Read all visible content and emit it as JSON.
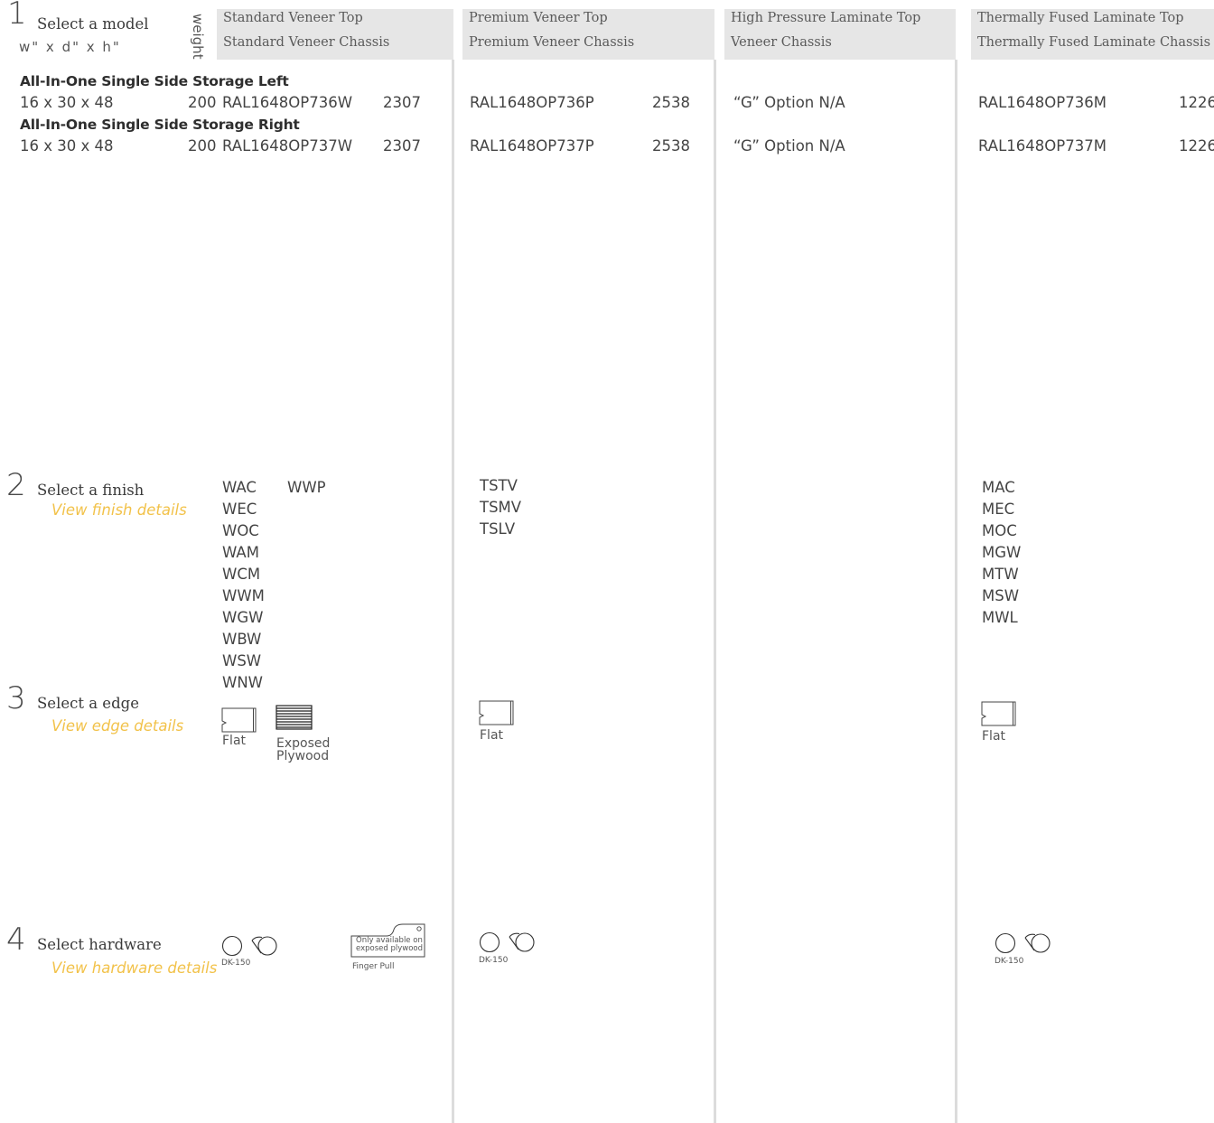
{
  "step1": {
    "number": "1",
    "title": "Select a model",
    "dims": "w\" x d\" x h\"",
    "weight_label": "weight"
  },
  "columns": [
    {
      "top": "Standard Veneer Top",
      "chassis": "Standard Veneer Chassis"
    },
    {
      "top": "Premium Veneer Top",
      "chassis": "Premium Veneer Chassis"
    },
    {
      "top": "High Pressure Laminate Top",
      "chassis": "Veneer Chassis"
    },
    {
      "top": "Thermally Fused Laminate Top",
      "chassis": "Thermally Fused Laminate Chassis"
    }
  ],
  "models": [
    {
      "name": "All-In-One Single Side Storage Left",
      "dims": "16 x 30 x 48",
      "weight": "200",
      "std_code": "RAL1648OP736W",
      "std_price": "2307",
      "prem_code": "RAL1648OP736P",
      "prem_price": "2538",
      "hpl": "“G” Option N/A",
      "tfl_code": "RAL1648OP736M",
      "tfl_price": "1226"
    },
    {
      "name": "All-In-One Single Side Storage Right",
      "dims": "16 x 30 x 48",
      "weight": "200",
      "std_code": "RAL1648OP737W",
      "std_price": "2307",
      "prem_code": "RAL1648OP737P",
      "prem_price": "2538",
      "hpl": "“G” Option N/A",
      "tfl_code": "RAL1648OP737M",
      "tfl_price": "1226"
    }
  ],
  "step2": {
    "number": "2",
    "title": "Select a finish",
    "link": "View finish details",
    "std_finishes": [
      "WAC",
      "WEC",
      "WOC",
      "WAM",
      "WCM",
      "WWM",
      "WGW",
      "WBW",
      "WSW",
      "WNW"
    ],
    "std_finishes_extra": "WWP",
    "prem_finishes": [
      "TSTV",
      "TSMV",
      "TSLV"
    ],
    "tfl_finishes": [
      "MAC",
      "MEC",
      "MOC",
      "MGW",
      "MTW",
      "MSW",
      "MWL"
    ]
  },
  "step3": {
    "number": "3",
    "title": "Select a edge",
    "link": "View edge details",
    "flat_label": "Flat",
    "plywood_label_1": "Exposed",
    "plywood_label_2": "Plywood"
  },
  "step4": {
    "number": "4",
    "title": "Select hardware",
    "link": "View hardware details",
    "dk_label": "DK-150",
    "finger_note_1": "Only available on",
    "finger_note_2": "exposed plywood",
    "finger_label": "Finger Pull"
  }
}
